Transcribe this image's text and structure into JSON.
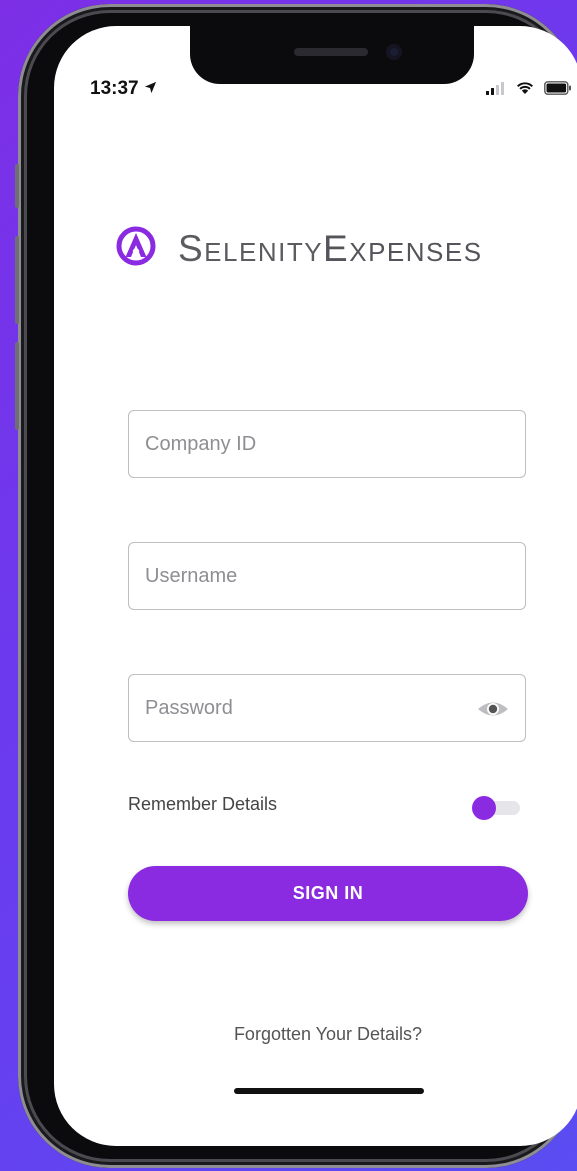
{
  "status_bar": {
    "time": "13:37",
    "location_icon": "location-arrow-icon",
    "signal_icon": "cellular-signal-icon",
    "wifi_icon": "wifi-icon",
    "battery_icon": "battery-icon"
  },
  "logo": {
    "icon": "selenity-logo-icon",
    "name_part1": "Selenity",
    "name_part2": "Expenses"
  },
  "form": {
    "company_id": {
      "placeholder": "Company ID",
      "value": ""
    },
    "username": {
      "placeholder": "Username",
      "value": ""
    },
    "password": {
      "placeholder": "Password",
      "value": "",
      "toggle_icon": "eye-icon"
    },
    "remember_label": "Remember Details",
    "remember_on": true,
    "signin_label": "SIGN IN",
    "forgot_label": "Forgotten Your Details?"
  },
  "colors": {
    "accent": "#8a2be2",
    "background_gradient_start": "#7d2fe6",
    "background_gradient_end": "#5a4df2"
  }
}
